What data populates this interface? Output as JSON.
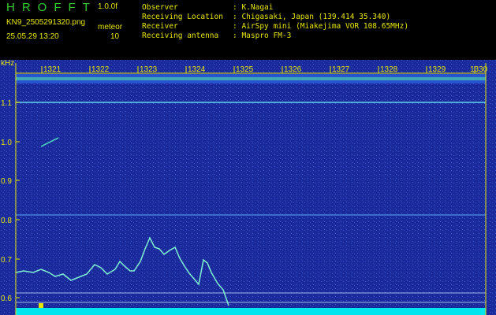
{
  "header": {
    "app_title": "HROFFT",
    "version": "1.0.0f",
    "filename": "KN9_2505291320.png",
    "timestamp": "25.05.29 13:20",
    "meteor_label": "meteor",
    "meteor_count": "10"
  },
  "info": [
    {
      "key": "Observer",
      "value": ": K.Nagai"
    },
    {
      "key": "Receiving Location",
      "value": ": Chigasaki, Japan (139.414 35.340)"
    },
    {
      "key": "Receiver",
      "value": ": AirSpy mini (Miakejima VOR 108.65MHz)"
    },
    {
      "key": "Receiving antenna",
      "value": ": Maspro FM-3"
    }
  ],
  "spectrogram": {
    "y_unit": "kHz",
    "y_ticks": [
      "1.1",
      "1.0",
      "0.9",
      "0.8",
      "0.7",
      "0.6"
    ],
    "x_ticks": [
      "1321",
      "1322",
      "1323",
      "1324",
      "1325",
      "1326",
      "1327",
      "1328",
      "1329",
      "1330"
    ],
    "colors": {
      "background": "#1a2a9a",
      "axis": "#e6e600",
      "trace": "#7ff0d0",
      "baseline": "#00e5ee"
    }
  }
}
